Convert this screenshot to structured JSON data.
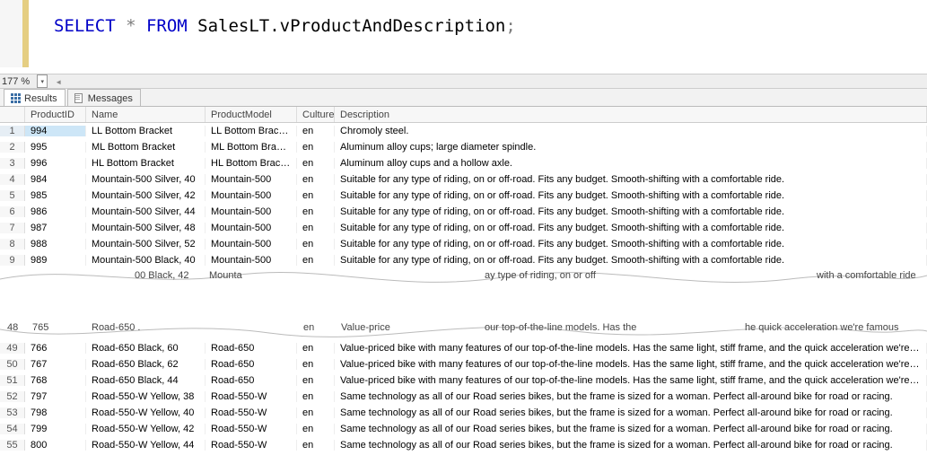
{
  "editor": {
    "sql_kw_select": "SELECT",
    "sql_star": " * ",
    "sql_kw_from": "FROM",
    "sql_obj": " SalesLT.vProductAndDescription",
    "sql_semi": ";"
  },
  "zoom": {
    "value": "177 %",
    "combo_glyph": "▾"
  },
  "tabs": {
    "results": "Results",
    "messages": "Messages"
  },
  "headers": {
    "pid": "ProductID",
    "name": "Name",
    "pm": "ProductModel",
    "cul": "Culture",
    "desc": "Description"
  },
  "rows_top": [
    {
      "rn": "1",
      "pid": "994",
      "name": "LL Bottom Bracket",
      "pm": "LL Bottom Bracket",
      "cul": "en",
      "desc": "Chromoly steel."
    },
    {
      "rn": "2",
      "pid": "995",
      "name": "ML Bottom Bracket",
      "pm": "ML Bottom Bracket",
      "cul": "en",
      "desc": "Aluminum alloy cups; large diameter spindle."
    },
    {
      "rn": "3",
      "pid": "996",
      "name": "HL Bottom Bracket",
      "pm": "HL Bottom Bracket",
      "cul": "en",
      "desc": "Aluminum alloy cups and a hollow axle."
    },
    {
      "rn": "4",
      "pid": "984",
      "name": "Mountain-500 Silver, 40",
      "pm": "Mountain-500",
      "cul": "en",
      "desc": "Suitable for any type of riding, on or off-road. Fits any budget. Smooth-shifting with a comfortable ride."
    },
    {
      "rn": "5",
      "pid": "985",
      "name": "Mountain-500 Silver, 42",
      "pm": "Mountain-500",
      "cul": "en",
      "desc": "Suitable for any type of riding, on or off-road. Fits any budget. Smooth-shifting with a comfortable ride."
    },
    {
      "rn": "6",
      "pid": "986",
      "name": "Mountain-500 Silver, 44",
      "pm": "Mountain-500",
      "cul": "en",
      "desc": "Suitable for any type of riding, on or off-road. Fits any budget. Smooth-shifting with a comfortable ride."
    },
    {
      "rn": "7",
      "pid": "987",
      "name": "Mountain-500 Silver, 48",
      "pm": "Mountain-500",
      "cul": "en",
      "desc": "Suitable for any type of riding, on or off-road. Fits any budget. Smooth-shifting with a comfortable ride."
    },
    {
      "rn": "8",
      "pid": "988",
      "name": "Mountain-500 Silver, 52",
      "pm": "Mountain-500",
      "cul": "en",
      "desc": "Suitable for any type of riding, on or off-road. Fits any budget. Smooth-shifting with a comfortable ride."
    },
    {
      "rn": "9",
      "pid": "989",
      "name": "Mountain-500 Black, 40",
      "pm": "Mountain-500",
      "cul": "en",
      "desc": "Suitable for any type of riding, on or off-road. Fits any budget. Smooth-shifting with a comfortable ride."
    }
  ],
  "tear_top_row": {
    "name_frag": "00 Black, 42",
    "pm_frag": "Mounta",
    "desc_frag1": "ay type of riding, on or off",
    "desc_frag2": "with a comfortable ride"
  },
  "tear_bottom_row": {
    "rn": "48",
    "pid": "765",
    "name": "Road-650 .",
    "cul": "en",
    "desc_frag1": "Value-price",
    "desc_frag2": "our top-of-the-line models. Has the",
    "desc_frag3": "he quick acceleration we're famous"
  },
  "rows_bottom": [
    {
      "rn": "49",
      "pid": "766",
      "name": "Road-650 Black, 60",
      "pm": "Road-650",
      "cul": "en",
      "desc": "Value-priced bike with many features of our top-of-the-line models. Has the same light, stiff frame, and the quick acceleration we're famous for."
    },
    {
      "rn": "50",
      "pid": "767",
      "name": "Road-650 Black, 62",
      "pm": "Road-650",
      "cul": "en",
      "desc": "Value-priced bike with many features of our top-of-the-line models. Has the same light, stiff frame, and the quick acceleration we're famous for."
    },
    {
      "rn": "51",
      "pid": "768",
      "name": "Road-650 Black, 44",
      "pm": "Road-650",
      "cul": "en",
      "desc": "Value-priced bike with many features of our top-of-the-line models. Has the same light, stiff frame, and the quick acceleration we're famous for."
    },
    {
      "rn": "52",
      "pid": "797",
      "name": "Road-550-W Yellow, 38",
      "pm": "Road-550-W",
      "cul": "en",
      "desc": "Same technology as all of our Road series bikes, but the frame is sized for a woman.  Perfect all-around bike for road or racing."
    },
    {
      "rn": "53",
      "pid": "798",
      "name": "Road-550-W Yellow, 40",
      "pm": "Road-550-W",
      "cul": "en",
      "desc": "Same technology as all of our Road series bikes, but the frame is sized for a woman.  Perfect all-around bike for road or racing."
    },
    {
      "rn": "54",
      "pid": "799",
      "name": "Road-550-W Yellow, 42",
      "pm": "Road-550-W",
      "cul": "en",
      "desc": "Same technology as all of our Road series bikes, but the frame is sized for a woman.  Perfect all-around bike for road or racing."
    },
    {
      "rn": "55",
      "pid": "800",
      "name": "Road-550-W Yellow, 44",
      "pm": "Road-550-W",
      "cul": "en",
      "desc": "Same technology as all of our Road series bikes, but the frame is sized for a woman.  Perfect all-around bike for road or racing."
    }
  ]
}
